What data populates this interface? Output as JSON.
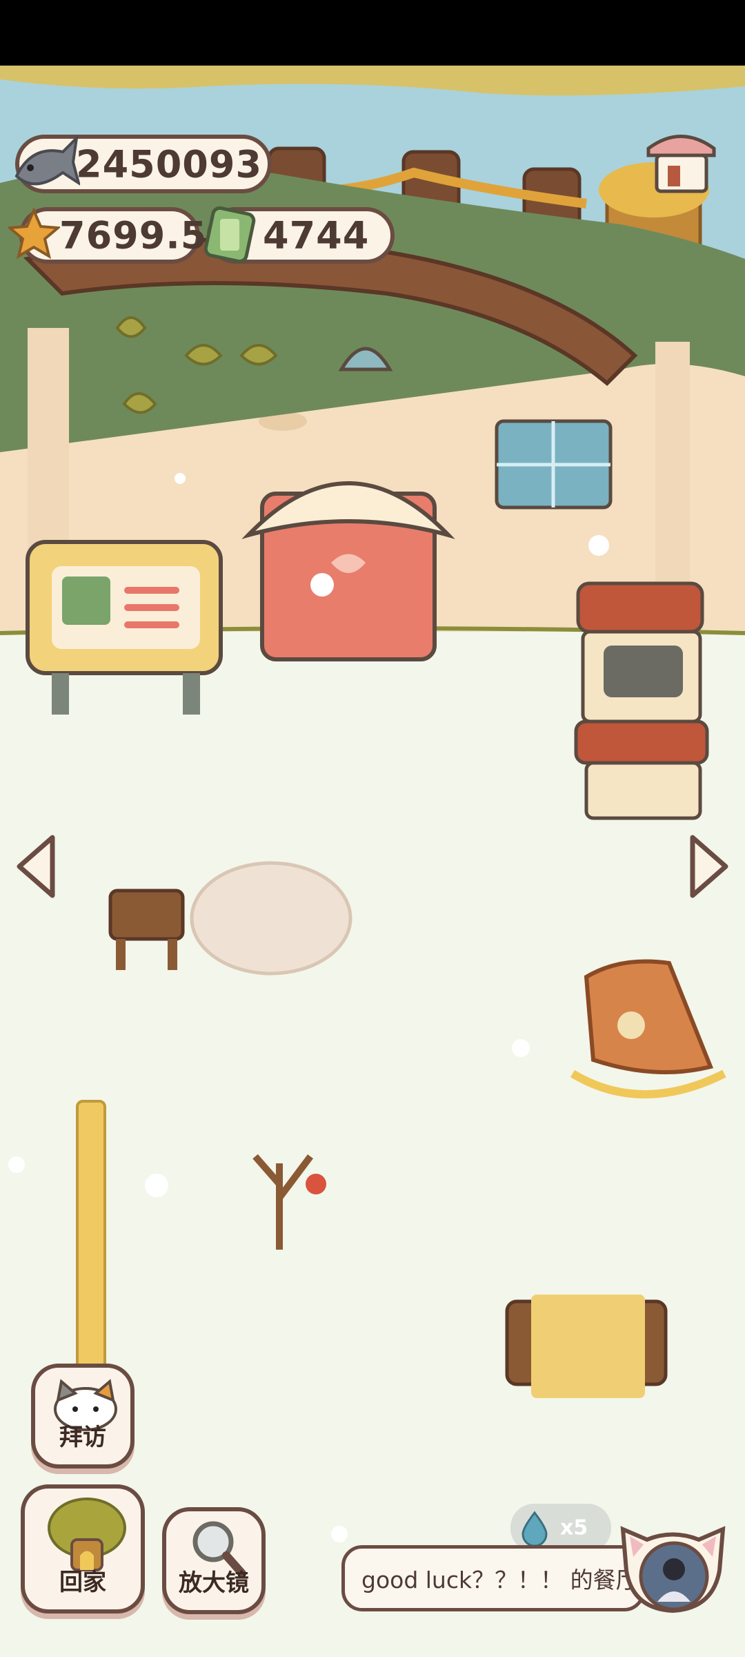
{
  "currency": {
    "fish": "2450093",
    "star": "7699.5",
    "ticket": "4744"
  },
  "buttons": {
    "visit": "拜访",
    "home": "回家",
    "magnifier": "放大镜"
  },
  "chat": {
    "message": "good luck？？！！ 的餐厅"
  },
  "water_drops": "x5",
  "icons": {
    "fish": "fish-icon",
    "star": "star-icon",
    "ticket": "ticket-icon",
    "shop": "shop-icon",
    "left": "chevron-left-icon",
    "right": "chevron-right-icon",
    "water": "water-drop-icon"
  },
  "colors": {
    "outline": "#6b4c42",
    "pill_bg": "#fbf3e6",
    "sky": "#a9d2dc",
    "wall": "#f5dfc0",
    "floor": "#f3f6ea"
  }
}
